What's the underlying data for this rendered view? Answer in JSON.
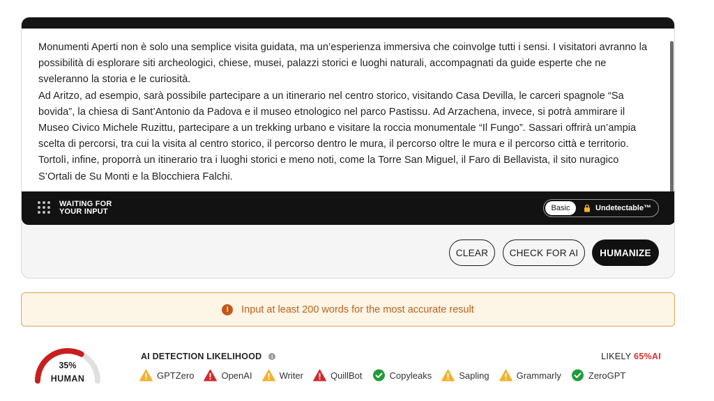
{
  "editor": {
    "paragraph1": "Monumenti Aperti non è solo una semplice visita guidata, ma un’esperienza immersiva che coinvolge tutti i sensi. I visitatori avranno la possibilità di esplorare siti archeologici, chiese, musei, palazzi storici e luoghi naturali, accompagnati da guide esperte che ne sveleranno la storia e le curiosità.",
    "paragraph2": "Ad Aritzo, ad esempio, sarà possibile partecipare a un itinerario nel centro storico, visitando Casa Devilla, le carceri spagnole “Sa bovida”, la chiesa di Sant’Antonio da Padova e il museo etnologico nel parco Pastissu. Ad Arzachena, invece, si potrà ammirare il Museo Civico Michele Ruzittu, partecipare a un trekking urbano e visitare la roccia monumentale “Il Fungo”. Sassari offrirà un’ampia scelta di percorsi, tra cui la visita al centro storico, il percorso dentro le mura, il percorso oltre le mura e il percorso città e territorio. Tortolì, infine, proporrà un itinerario tra i luoghi storici e meno noti, come la Torre San Miguel, il Faro di Bellavista, il sito nuragico S’Ortali de Su Monti e la Blocchiera Falchi."
  },
  "status": {
    "line1": "WAITING FOR",
    "line2": "YOUR INPUT",
    "mode_basic": "Basic",
    "mode_undetectable": "Undetectable™"
  },
  "buttons": {
    "clear": "CLEAR",
    "check": "CHECK FOR AI",
    "humanize": "HUMANIZE"
  },
  "alert": {
    "icon": "!",
    "text": "Input at least 200 words for the most accurate result"
  },
  "result": {
    "human_percent_value": 35,
    "human_percent": "35%",
    "human_label": "HUMAN",
    "title": "AI DETECTION LIKELIHOOD",
    "likely_prefix": "LIKELY",
    "likely_pct": "65%AI",
    "detectors": [
      {
        "name": "GPTZero",
        "status": "warning"
      },
      {
        "name": "OpenAI",
        "status": "fail"
      },
      {
        "name": "Writer",
        "status": "warning"
      },
      {
        "name": "QuillBot",
        "status": "fail"
      },
      {
        "name": "Copyleaks",
        "status": "pass"
      },
      {
        "name": "Sapling",
        "status": "warning"
      },
      {
        "name": "Grammarly",
        "status": "warning"
      },
      {
        "name": "ZeroGPT",
        "status": "pass"
      }
    ]
  },
  "colors": {
    "warning": "#f2b12e",
    "fail": "#d12b2b",
    "pass": "#1f9d3a",
    "gauge_red": "#c81e1e",
    "gauge_grey": "#e0e0e0"
  }
}
